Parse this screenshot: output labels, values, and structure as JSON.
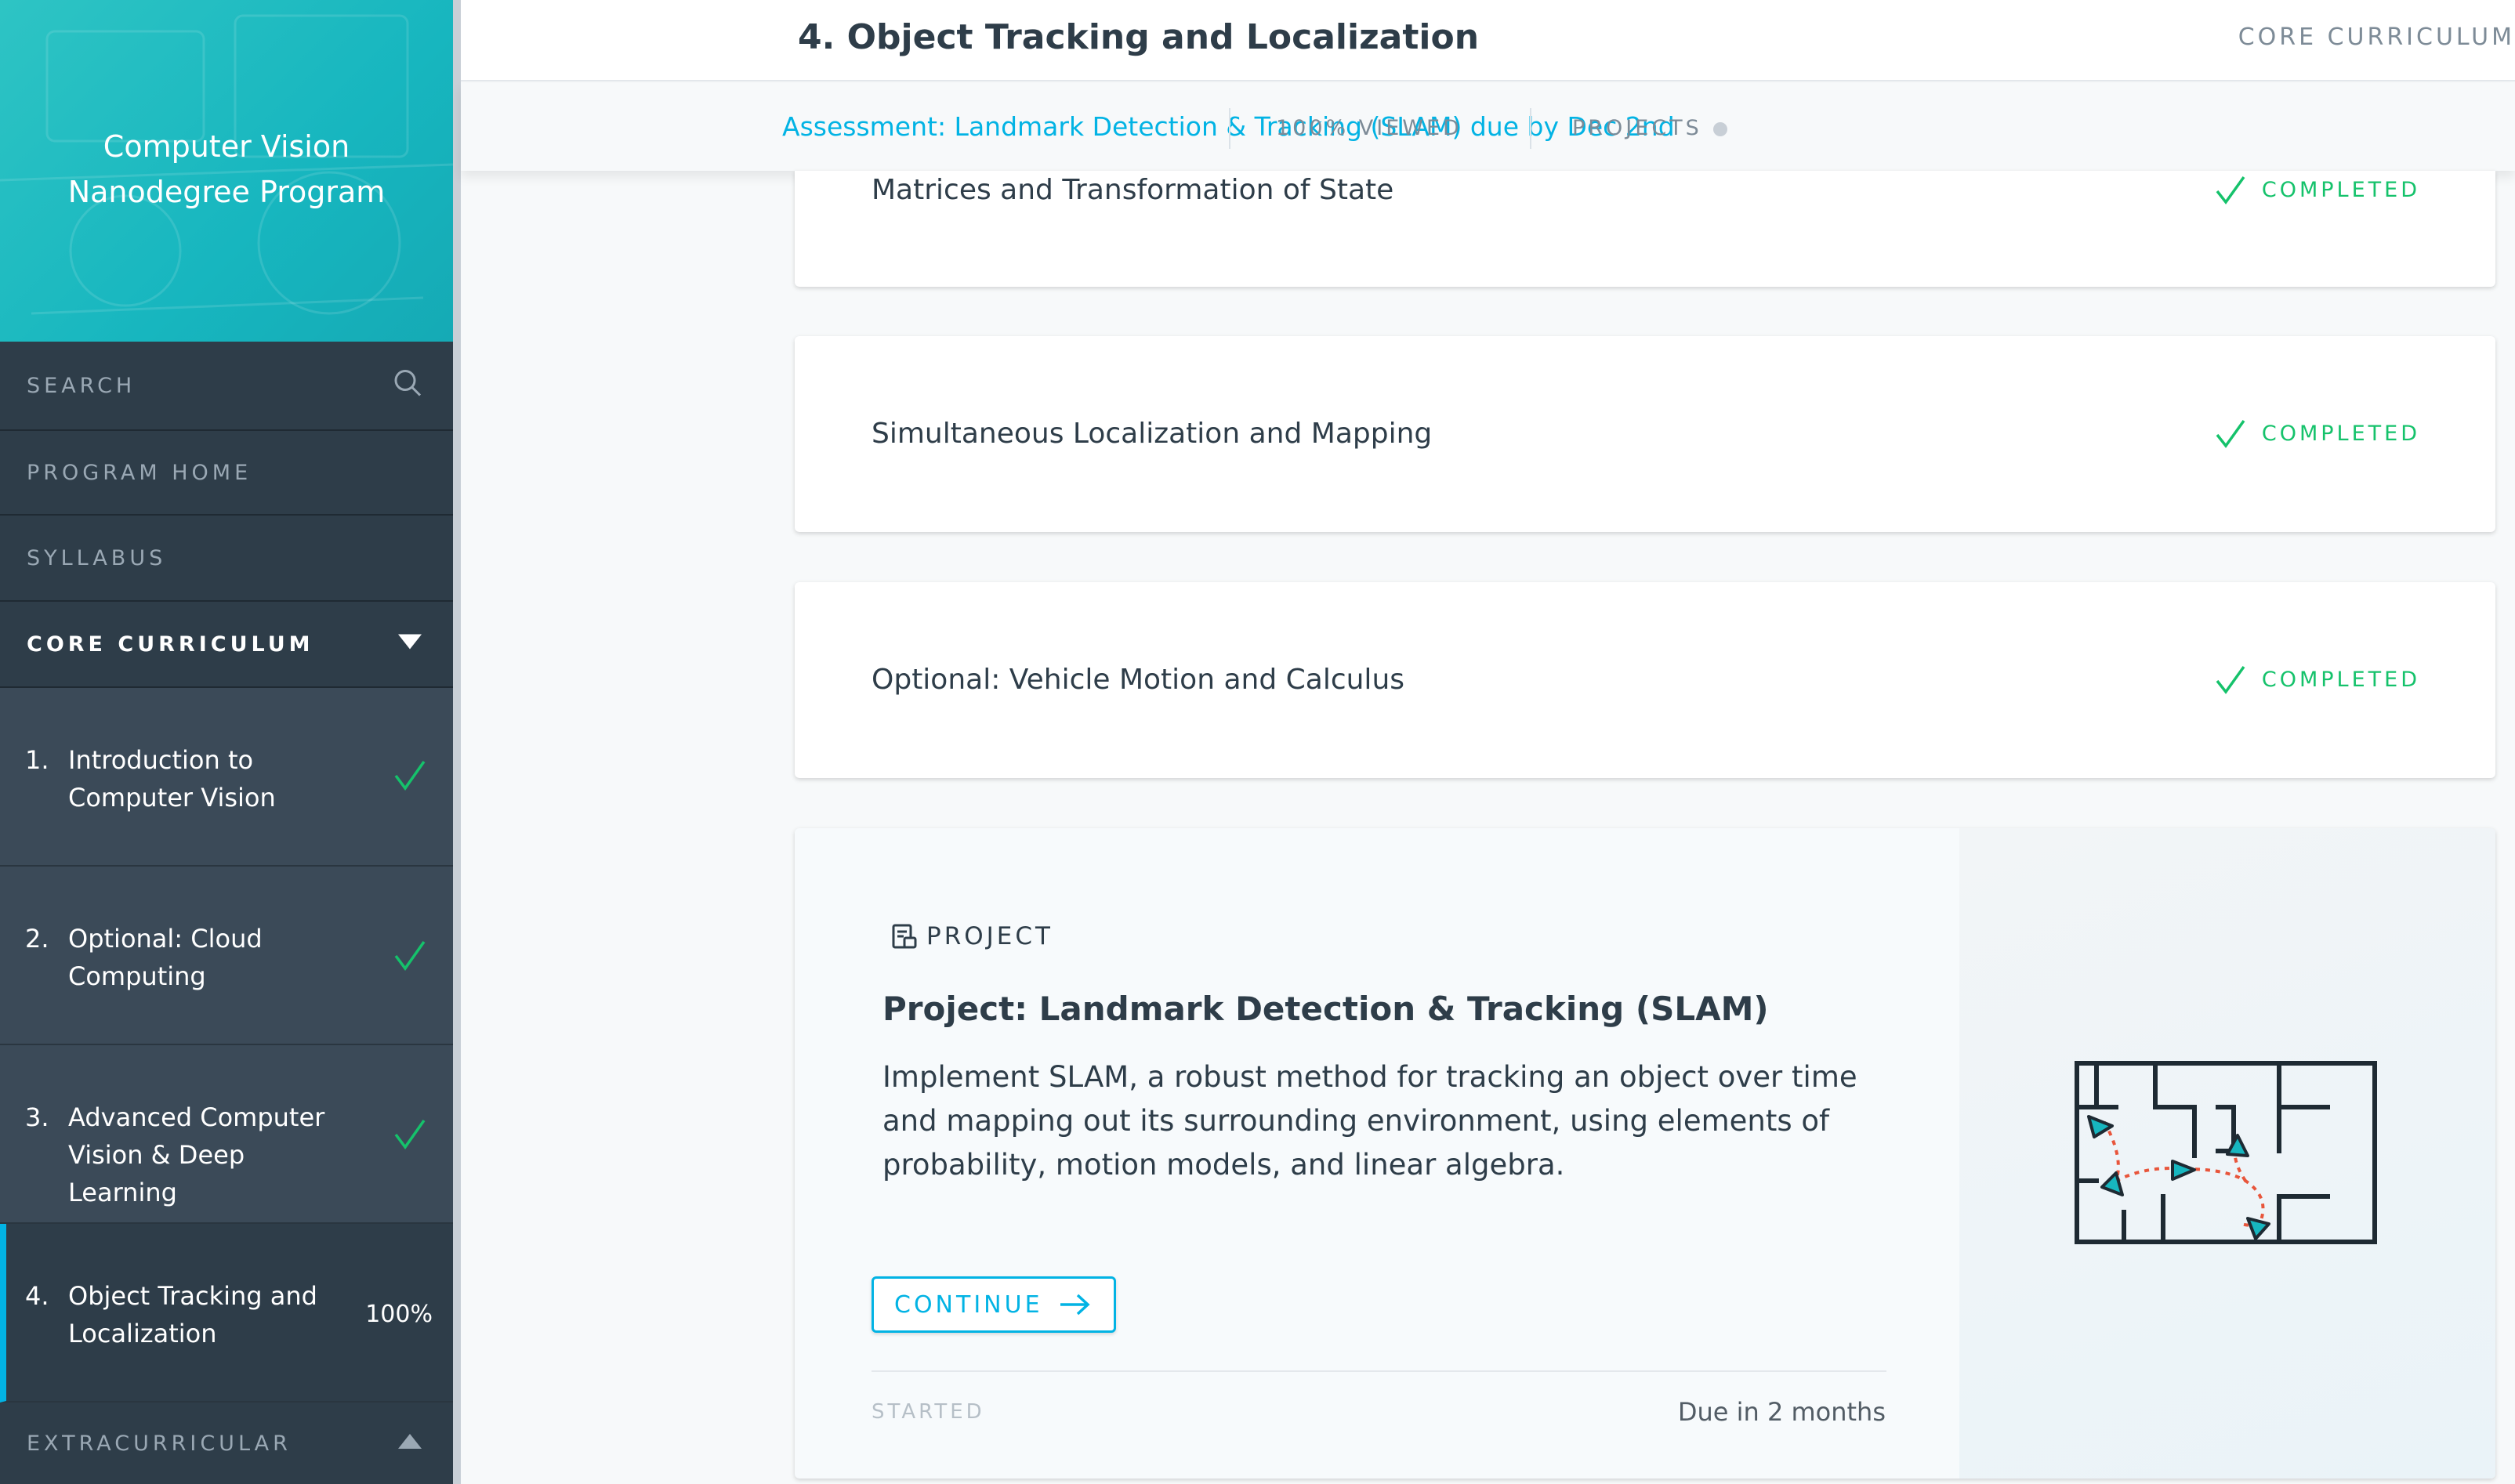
{
  "brand": {
    "title_line1": "Computer Vision",
    "title_line2": "Nanodegree Program"
  },
  "sidebar": {
    "search_label": "SEARCH",
    "program_home": "PROGRAM HOME",
    "syllabus": "SYLLABUS",
    "core_curriculum": "CORE CURRICULUM",
    "lessons": [
      {
        "num": "1.",
        "title": "Introduction to Computer Vision",
        "completed": true
      },
      {
        "num": "2.",
        "title": "Optional: Cloud Computing",
        "completed": true
      },
      {
        "num": "3.",
        "title": "Advanced Computer Vision & Deep Learning",
        "completed": true
      },
      {
        "num": "4.",
        "title": "Object Tracking and Localization",
        "progress": "100%"
      }
    ],
    "extracurricular": "EXTRACURRICULAR"
  },
  "header": {
    "title": "4. Object Tracking and Localization",
    "section": "CORE CURRICULUM",
    "assessment": "Assessment: Landmark Detection & Tracking (SLAM) due by Dec 2nd",
    "viewed": "100% VIEWED",
    "projects": "PROJECTS"
  },
  "cards": [
    {
      "title": "Matrices and Transformation of State",
      "status": "COMPLETED"
    },
    {
      "title": "Simultaneous Localization and Mapping",
      "status": "COMPLETED"
    },
    {
      "title": "Optional: Vehicle Motion and Calculus",
      "status": "COMPLETED"
    }
  ],
  "project": {
    "kicker": "PROJECT",
    "title": "Project: Landmark Detection & Tracking (SLAM)",
    "description": "Implement SLAM, a robust method for tracking an object over time and mapping out its surrounding environment, using elements of probability, motion models, and linear algebra.",
    "continue_label": "CONTINUE",
    "started": "STARTED",
    "due": "Due in 2 months"
  },
  "colors": {
    "accent": "#02b3e4",
    "success": "#15c26b",
    "sidebar": "#2e3d49",
    "brand": "#17b6bf"
  }
}
